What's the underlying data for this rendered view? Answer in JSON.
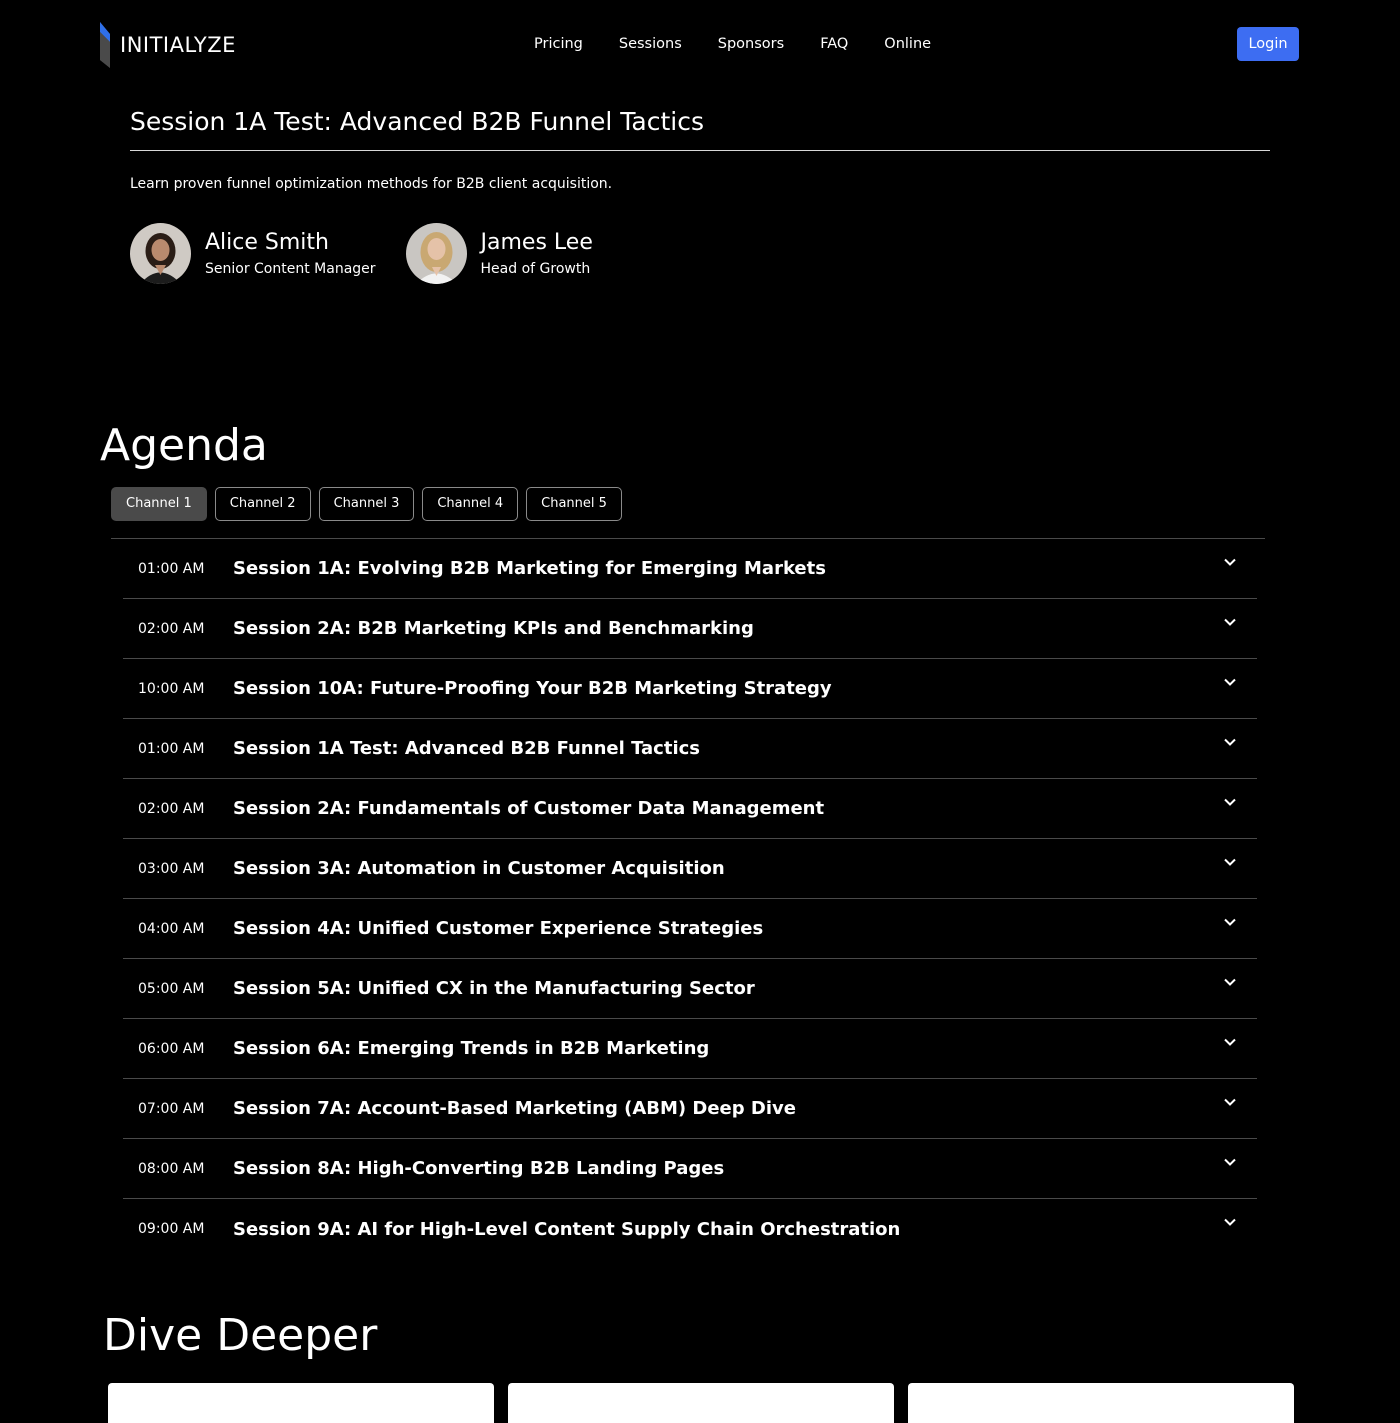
{
  "header": {
    "logo_text": "INITIALYZE",
    "nav": [
      "Pricing",
      "Sessions",
      "Sponsors",
      "FAQ",
      "Online"
    ],
    "login_label": "Login",
    "accent_color": "#3d6df2"
  },
  "session": {
    "title": "Session 1A Test: Advanced B2B Funnel Tactics",
    "description": "Learn proven funnel optimization methods for B2B client acquisition.",
    "speakers": [
      {
        "name": "Alice Smith",
        "role": "Senior Content Manager"
      },
      {
        "name": "James Lee",
        "role": "Head of Growth"
      }
    ]
  },
  "agenda": {
    "heading": "Agenda",
    "tabs": [
      "Channel 1",
      "Channel 2",
      "Channel 3",
      "Channel 4",
      "Channel 5"
    ],
    "active_tab": "Channel 1",
    "items": [
      {
        "time": "01:00 AM",
        "title": "Session 1A: Evolving B2B Marketing for Emerging Markets"
      },
      {
        "time": "02:00 AM",
        "title": "Session 2A: B2B Marketing KPIs and Benchmarking"
      },
      {
        "time": "10:00 AM",
        "title": "Session 10A: Future-Proofing Your B2B Marketing Strategy"
      },
      {
        "time": "01:00 AM",
        "title": "Session 1A Test: Advanced B2B Funnel Tactics"
      },
      {
        "time": "02:00 AM",
        "title": "Session 2A: Fundamentals of Customer Data Management"
      },
      {
        "time": "03:00 AM",
        "title": "Session 3A: Automation in Customer Acquisition"
      },
      {
        "time": "04:00 AM",
        "title": "Session 4A: Unified Customer Experience Strategies"
      },
      {
        "time": "05:00 AM",
        "title": "Session 5A: Unified CX in the Manufacturing Sector"
      },
      {
        "time": "06:00 AM",
        "title": "Session 6A: Emerging Trends in B2B Marketing"
      },
      {
        "time": "07:00 AM",
        "title": "Session 7A: Account-Based Marketing (ABM) Deep Dive"
      },
      {
        "time": "08:00 AM",
        "title": "Session 8A: High-Converting B2B Landing Pages"
      },
      {
        "time": "09:00 AM",
        "title": "Session 9A: AI for High-Level Content Supply Chain Orchestration"
      }
    ]
  },
  "dive_deeper": {
    "heading": "Dive Deeper"
  }
}
